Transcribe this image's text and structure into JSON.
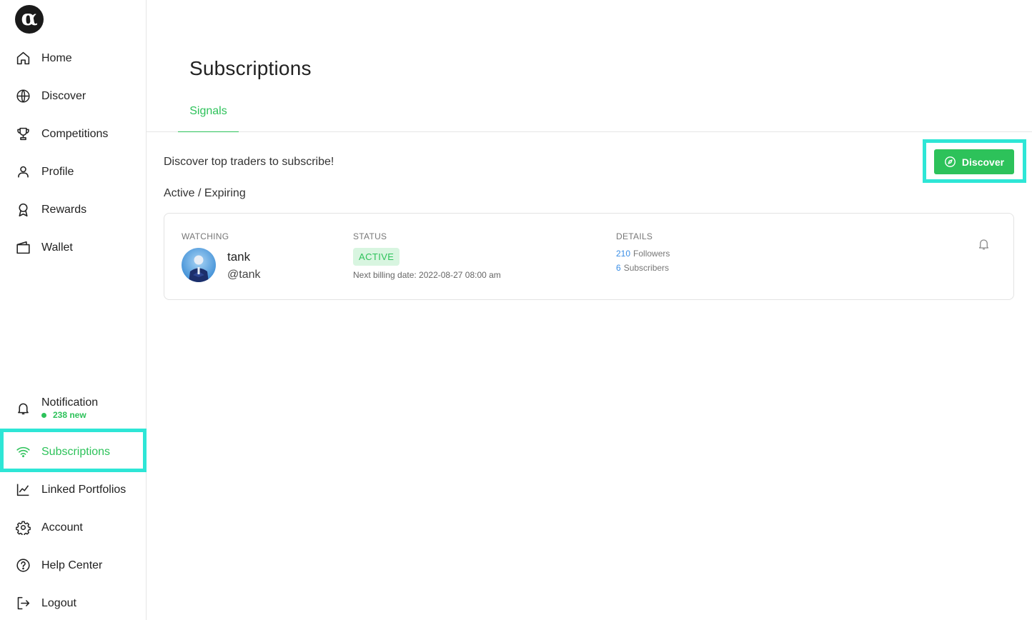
{
  "app": {
    "logo_glyph": "α"
  },
  "sidebar": {
    "items": [
      {
        "label": "Home",
        "icon": "home-icon"
      },
      {
        "label": "Discover",
        "icon": "globe-icon"
      },
      {
        "label": "Competitions",
        "icon": "trophy-icon"
      },
      {
        "label": "Profile",
        "icon": "user-icon"
      },
      {
        "label": "Rewards",
        "icon": "award-icon"
      },
      {
        "label": "Wallet",
        "icon": "wallet-icon"
      }
    ],
    "notification": {
      "label": "Notification",
      "sub": "238 new",
      "icon": "bell-icon"
    },
    "bottom_items": [
      {
        "label": "Subscriptions",
        "icon": "wifi-icon",
        "active": true
      },
      {
        "label": "Linked Portfolios",
        "icon": "chart-line-icon"
      },
      {
        "label": "Account",
        "icon": "gear-icon"
      },
      {
        "label": "Help Center",
        "icon": "help-circle-icon"
      },
      {
        "label": "Logout",
        "icon": "logout-icon"
      }
    ]
  },
  "main": {
    "title": "Subscriptions",
    "tabs": [
      {
        "label": "Signals",
        "active": true
      }
    ],
    "intro": "Discover top traders to subscribe!",
    "discover_button": "Discover",
    "section_label": "Active / Expiring",
    "subscriptions": [
      {
        "headers": {
          "watching": "WATCHING",
          "status": "STATUS",
          "details": "DETAILS"
        },
        "name": "tank",
        "handle": "@tank",
        "status": "ACTIVE",
        "billing": "Next billing date: 2022-08-27 08:00 am",
        "followers_count": "210",
        "followers_label": "Followers",
        "subscribers_count": "6",
        "subscribers_label": "Subscribers"
      }
    ]
  },
  "colors": {
    "accent": "#2dc25a",
    "highlight": "#2ee6d6",
    "link": "#3a8ee6"
  }
}
